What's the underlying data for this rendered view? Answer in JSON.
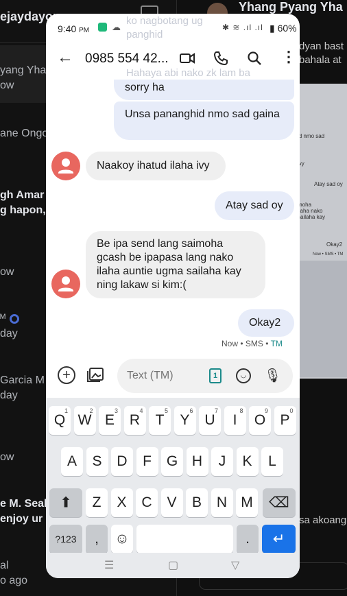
{
  "background": {
    "left_title": "ejaydayon",
    "conversations": [
      {
        "line1": "yang Yha",
        "line2": "ow",
        "bold": false
      },
      {
        "line1": "ane Ongo",
        "line2": "",
        "bold": false
      },
      {
        "line1": "gh Amar",
        "line2": "g hapon,",
        "bold": true
      },
      {
        "line1": "ow",
        "line2": "",
        "bold": false
      },
      {
        "line1": "day",
        "line2": "",
        "bold": false
      },
      {
        "line1": "Garcia M",
        "line2": "day",
        "bold": false
      },
      {
        "line1": "ow",
        "line2": "",
        "bold": false
      },
      {
        "line1": "e M. Seal",
        "line2": "enjoy ur",
        "bold": true
      },
      {
        "line1": "al",
        "line2": "o ago",
        "bold": false
      }
    ],
    "right_header": "Yhang Pyang Yha",
    "right_message": "dyan bast\nbahala at",
    "right_message2": "sa akoang",
    "mini_phone_texts": [
      "ld nmo sad",
      "ivy",
      "Atay sad oy",
      "moha\nilaha nako\nsailaha kay",
      "Okay2",
      "Now • SMS • TM"
    ]
  },
  "status_bar": {
    "time": "9:40",
    "ampm": "PM",
    "battery": "60%",
    "indicators": "✱ ≋ .ıl .ıl"
  },
  "ghost_text": {
    "line1": "ko nagbotang ug",
    "line2": "panghid",
    "line3": "Hahaya abi nako zk lam ba"
  },
  "app_bar": {
    "back_icon": "arrow-left",
    "contact": "0985 554 42...",
    "icons": [
      "video-icon",
      "phone-icon",
      "search-icon",
      "more-icon"
    ]
  },
  "messages": [
    {
      "direction": "out",
      "text": "sorry ha"
    },
    {
      "direction": "out",
      "text": "Unsa pananghid nmo sad gaina"
    },
    {
      "direction": "in",
      "text": "Naakoy ihatud ilaha ivy"
    },
    {
      "direction": "out",
      "text": "Atay sad oy"
    },
    {
      "direction": "in",
      "text": "Be ipa send lang saimoha gcash be ipapasa lang nako ilaha auntie ugma sailaha kay ning lakaw si kim:("
    },
    {
      "direction": "out",
      "text": "Okay2"
    }
  ],
  "message_meta": {
    "time": "Now",
    "sep": " • ",
    "type": "SMS",
    "carrier": "TM"
  },
  "composer": {
    "placeholder": "Text (TM)",
    "sim_label": "1"
  },
  "keyboard": {
    "row1": [
      {
        "k": "Q",
        "h": "1"
      },
      {
        "k": "W",
        "h": "2"
      },
      {
        "k": "E",
        "h": "3"
      },
      {
        "k": "R",
        "h": "4"
      },
      {
        "k": "T",
        "h": "5"
      },
      {
        "k": "Y",
        "h": "6"
      },
      {
        "k": "U",
        "h": "7"
      },
      {
        "k": "I",
        "h": "8"
      },
      {
        "k": "O",
        "h": "9"
      },
      {
        "k": "P",
        "h": "0"
      }
    ],
    "row2": [
      "A",
      "S",
      "D",
      "F",
      "G",
      "H",
      "J",
      "K",
      "L"
    ],
    "row3": [
      "Z",
      "X",
      "C",
      "V",
      "B",
      "N",
      "M"
    ],
    "symbols_label": "?123",
    "comma": ",",
    "period": ".",
    "shift_icon": "⬆",
    "backspace_icon": "⌫",
    "enter_icon": "↵",
    "emoji_icon": "☺"
  },
  "nav_bar": {
    "recents": "☰",
    "home": "▢",
    "back": "▽"
  },
  "colors": {
    "outgoing_bubble": "#e7ecf9",
    "incoming_bubble": "#efefef",
    "avatar": "#e8675f",
    "accent": "#1a73e8",
    "carrier": "#1b8a8a"
  }
}
